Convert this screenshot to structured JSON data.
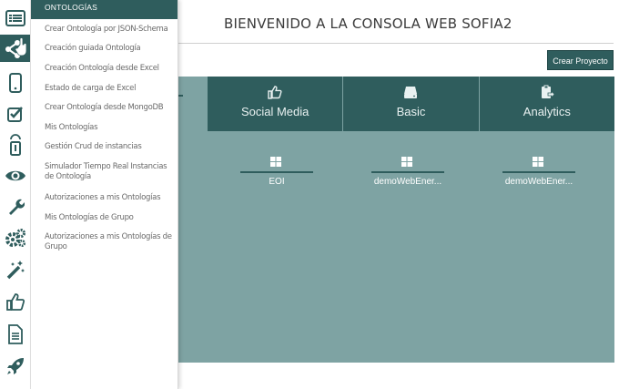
{
  "page": {
    "title": "BIENVENIDO A LA CONSOLA WEB SOFIA2"
  },
  "toolbar": {
    "create_project_label": "Crear Proyecto"
  },
  "colors": {
    "primary": "#2f5d5d",
    "panel": "#7ea3a3",
    "menu_text": "#6a6a6a"
  },
  "sidebar": {
    "icons": [
      "list-icon",
      "ontology-share-icon",
      "mobile-icon",
      "checkbox-icon",
      "gateway-icon",
      "eye-icon",
      "wrench-icon",
      "gears-icon",
      "magic-wand-icon",
      "thumbs-up-icon",
      "document-icon",
      "rocket-icon"
    ],
    "active_index": 1
  },
  "menu": {
    "header": "ONTOLOGÍAS",
    "items": [
      "Crear Ontología por JSON-Schema",
      "Creación guiada Ontología",
      "Creación Ontología desde Excel",
      "Estado de carga de Excel",
      "Crear Ontología desde MongoDB",
      "Mis Ontologías",
      "Gestión Crud de instancias",
      "Simulador Tiempo Real Instancias de Ontología",
      "Autorizaciones a mis Ontologías",
      "Mis Ontologías de Grupo",
      "Autorizaciones a mis Ontologías de Grupo"
    ]
  },
  "categories": [
    {
      "label": "Social Media",
      "icon": "thumbs-up-outline-icon"
    },
    {
      "label": "Basic",
      "icon": "hard-drive-icon"
    },
    {
      "label": "Analytics",
      "icon": "clipboard-icon"
    }
  ],
  "projects": [
    {
      "name": "EOI"
    },
    {
      "name": "demoWebEner..."
    },
    {
      "name": "demoWebEner..."
    }
  ]
}
